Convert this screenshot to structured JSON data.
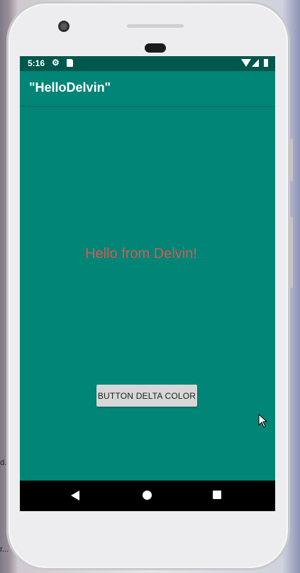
{
  "status_bar": {
    "time": "5:16",
    "icons": [
      "gear-icon",
      "sd-card-icon",
      "wifi-icon",
      "cellular-signal-icon",
      "battery-icon"
    ]
  },
  "app_bar": {
    "title": "\"HelloDelvin\""
  },
  "main": {
    "greeting": "Hello from Delvin!",
    "button_label": "BUTTON DELTA COLOR"
  },
  "nav_bar": {
    "icons": [
      "back-icon",
      "home-icon",
      "recents-icon"
    ]
  },
  "background_fragments": {
    "left_1": "d.",
    "left_2": "r..."
  },
  "colors": {
    "primary": "#008577",
    "primary_dark": "#00574b",
    "greeting_text": "#d65a4f",
    "button_bg": "#d6d7d7"
  }
}
